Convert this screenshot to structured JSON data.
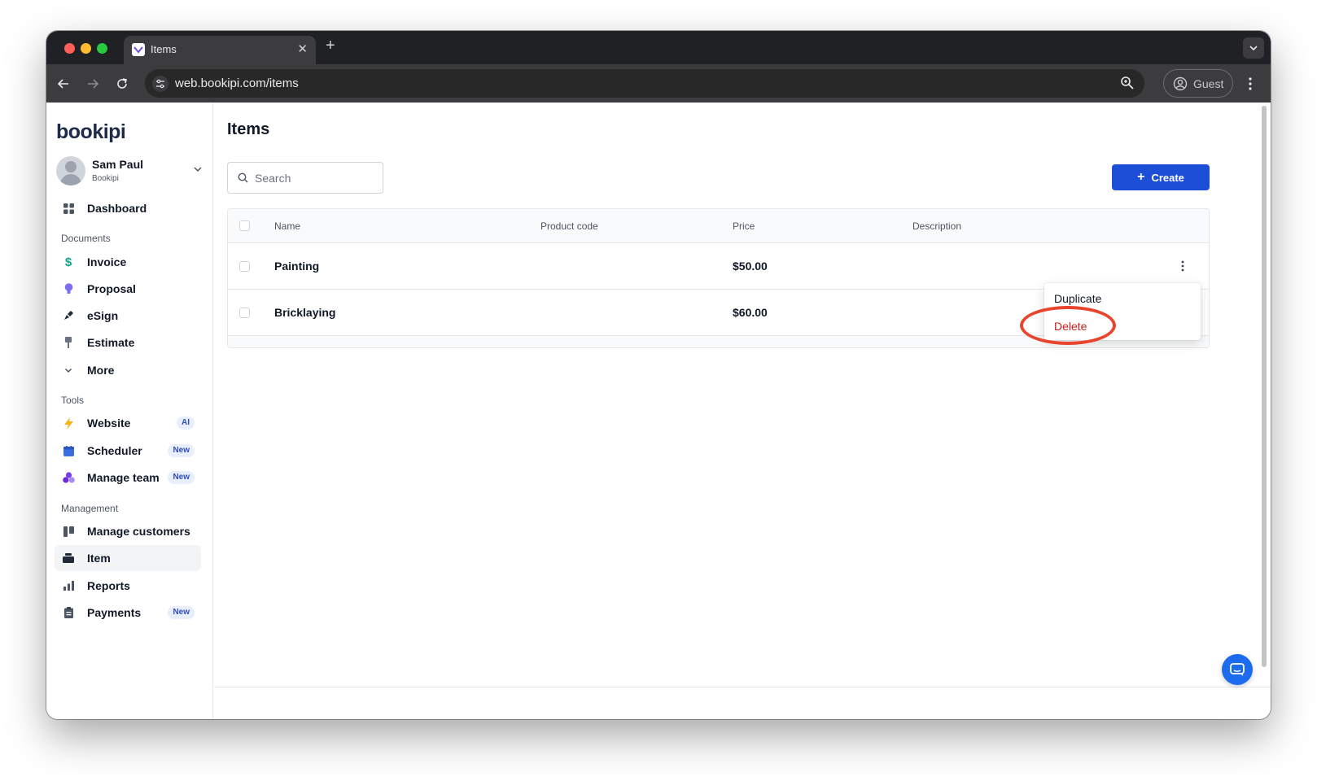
{
  "browser": {
    "tab_title": "Items",
    "url": "web.bookipi.com/items",
    "profile_label": "Guest"
  },
  "sidebar": {
    "logo_text": "bookipi",
    "account": {
      "name": "Sam Paul",
      "org": "Bookipi"
    },
    "dashboard_label": "Dashboard",
    "sections": {
      "documents": "Documents",
      "tools": "Tools",
      "management": "Management"
    },
    "documents": [
      {
        "label": "Invoice",
        "icon": "dollar-icon"
      },
      {
        "label": "Proposal",
        "icon": "lightbulb-icon"
      },
      {
        "label": "eSign",
        "icon": "pen-icon"
      },
      {
        "label": "Estimate",
        "icon": "pin-icon"
      },
      {
        "label": "More",
        "icon": "chevron-down-icon"
      }
    ],
    "tools": [
      {
        "label": "Website",
        "badge": "AI",
        "icon": "lightning-icon"
      },
      {
        "label": "Scheduler",
        "badge": "New",
        "icon": "calendar-icon"
      },
      {
        "label": "Manage team",
        "badge": "New",
        "icon": "team-icon"
      }
    ],
    "management": [
      {
        "label": "Manage customers",
        "icon": "customers-icon"
      },
      {
        "label": "Item",
        "icon": "item-icon"
      },
      {
        "label": "Reports",
        "icon": "bar-chart-icon"
      },
      {
        "label": "Payments",
        "badge": "New",
        "icon": "clipboard-icon"
      }
    ]
  },
  "main": {
    "title": "Items",
    "search_placeholder": "Search",
    "create_label": "Create",
    "columns": [
      "Name",
      "Product code",
      "Price",
      "Description"
    ],
    "rows": [
      {
        "name": "Painting",
        "code": "",
        "price": "$50.00",
        "description": ""
      },
      {
        "name": "Bricklaying",
        "code": "",
        "price": "$60.00",
        "description": ""
      }
    ],
    "menu": {
      "duplicate": "Duplicate",
      "delete": "Delete"
    }
  },
  "colors": {
    "accent": "#1d4ed8",
    "danger": "#c81e1e",
    "highlight": "#e8452c",
    "chrome_dark": "#202124"
  }
}
